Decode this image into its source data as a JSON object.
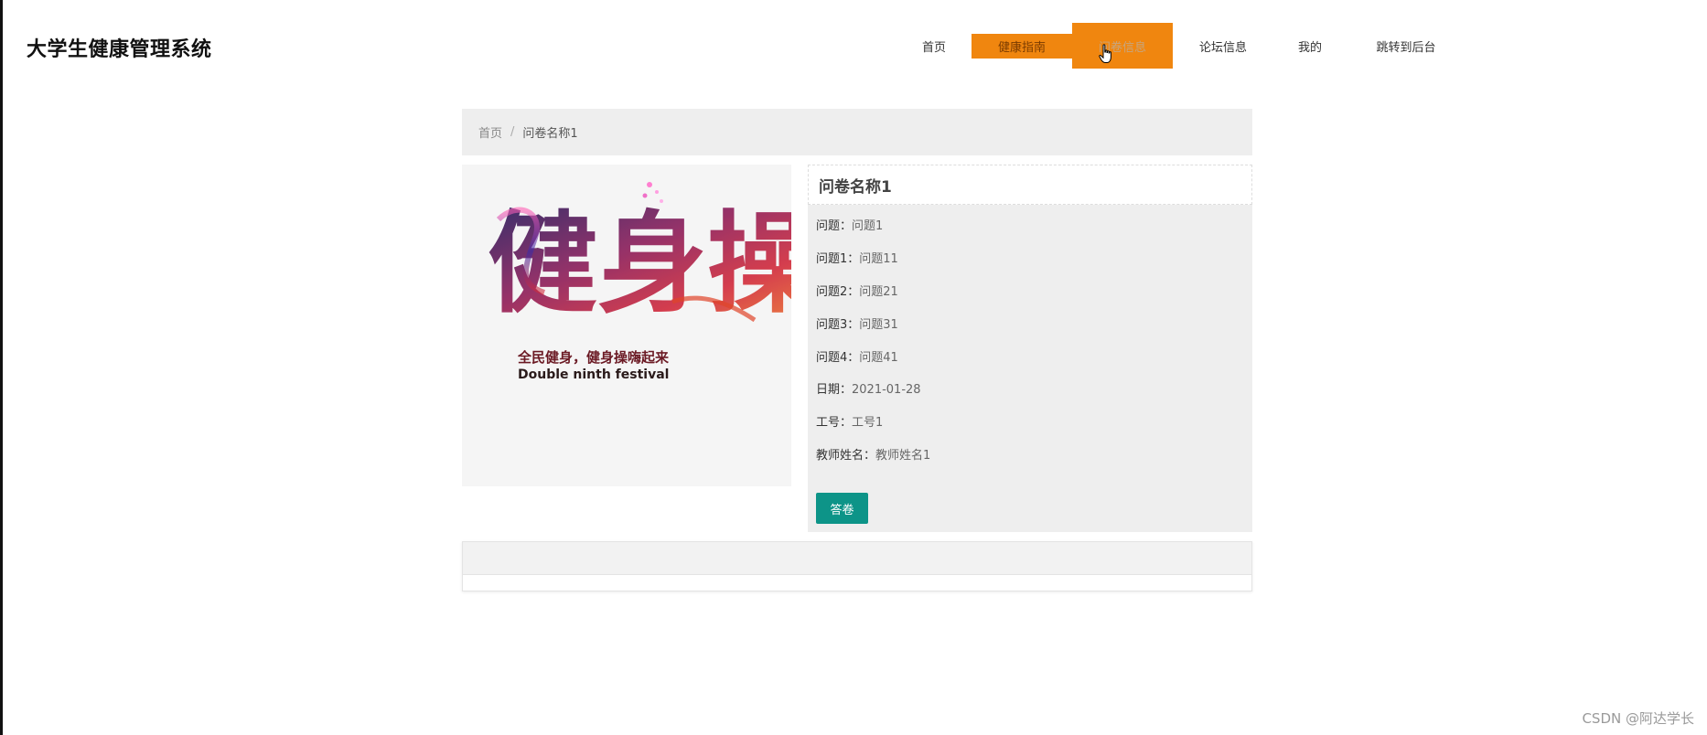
{
  "header": {
    "site_title": "大学生健康管理系统"
  },
  "nav": {
    "items": [
      {
        "label": "首页"
      },
      {
        "label": "健康指南"
      },
      {
        "label": "问卷信息"
      },
      {
        "label": "论坛信息"
      },
      {
        "label": "我的"
      },
      {
        "label": "跳转到后台"
      }
    ],
    "accent_color": "#f0860f"
  },
  "breadcrumb": {
    "home": "首页",
    "separator": "/",
    "current": "问卷名称1"
  },
  "poster": {
    "calligraphy": "健身操",
    "caption_cn": "全民健身，健身操嗨起来",
    "caption_en": "Double ninth festival"
  },
  "detail": {
    "title": "问卷名称1",
    "fields": [
      {
        "label": "问题：",
        "value": "问题1"
      },
      {
        "label": "问题1：",
        "value": "问题11"
      },
      {
        "label": "问题2：",
        "value": "问题21"
      },
      {
        "label": "问题3：",
        "value": "问题31"
      },
      {
        "label": "问题4：",
        "value": "问题41"
      },
      {
        "label": "日期：",
        "value": "2021-01-28"
      },
      {
        "label": "工号：",
        "value": "工号1"
      },
      {
        "label": "教师姓名：",
        "value": "教师姓名1"
      }
    ],
    "answer_label": "答卷",
    "button_color": "#0d9488"
  },
  "watermark": "CSDN @阿达学长"
}
